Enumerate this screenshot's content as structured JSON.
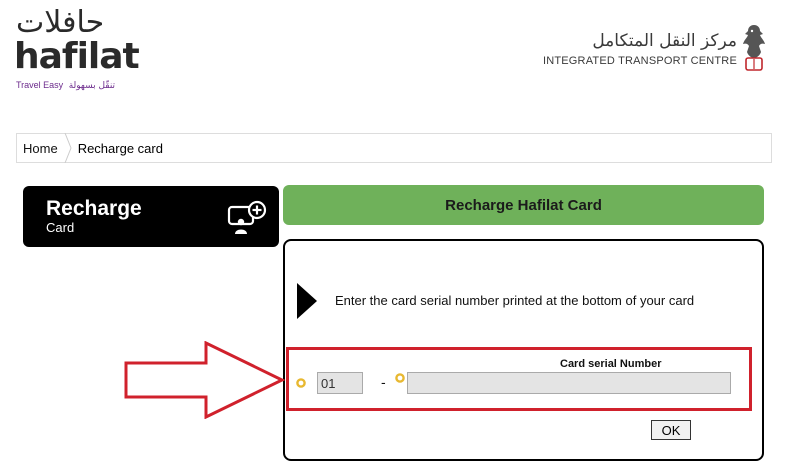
{
  "brand": {
    "logo_arabic": "حافلات",
    "logo_latin": "hafilat",
    "tagline_en": "Travel Easy",
    "tagline_ar": "تنقّل بسهولة",
    "itc_arabic": "مركز النقل المتكامل",
    "itc_english": "INTEGRATED TRANSPORT CENTRE"
  },
  "breadcrumb": {
    "items": [
      {
        "label": "Home"
      },
      {
        "label": "Recharge card"
      }
    ]
  },
  "sidebar": {
    "title": "Recharge",
    "subtitle": "Card"
  },
  "form": {
    "header": "Recharge Hafilat Card",
    "instruction": "Enter the card serial number printed at the bottom of your card",
    "serial_label": "Card serial Number",
    "prefix_value": "01",
    "separator": "-",
    "serial_value": "",
    "ok_label": "OK"
  },
  "colors": {
    "header_green": "#6fb15a",
    "annotation_red": "#d0212c",
    "required_dot": "#e8b830",
    "brand_purple": "#6d2c8d"
  }
}
